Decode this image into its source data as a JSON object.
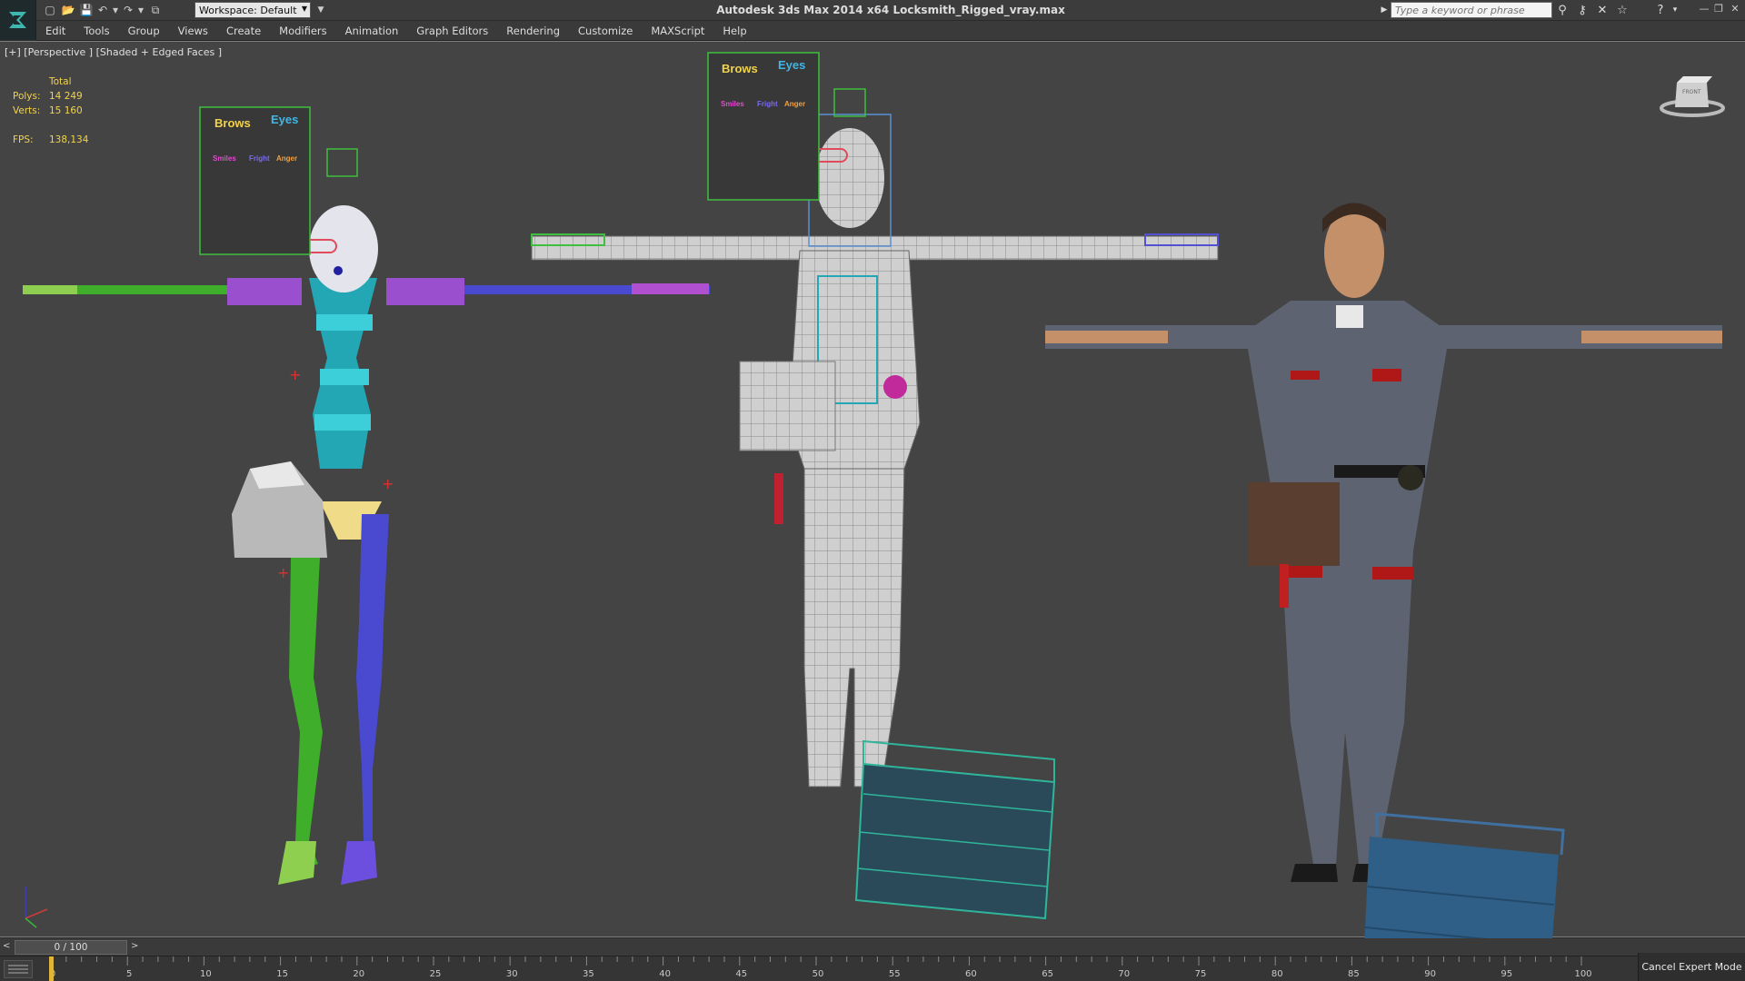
{
  "titlebar": {
    "workspace_label": "Workspace: Default",
    "app_title": "Autodesk 3ds Max  2014 x64     Locksmith_Rigged_vray.max",
    "search_placeholder": "Type a keyword or phrase"
  },
  "menu": [
    "Edit",
    "Tools",
    "Group",
    "Views",
    "Create",
    "Modifiers",
    "Animation",
    "Graph Editors",
    "Rendering",
    "Customize",
    "MAXScript",
    "Help"
  ],
  "viewport": {
    "label": "[+] [Perspective ] [Shaded + Edged Faces ]",
    "stats": {
      "total_label": "Total",
      "polys_label": "Polys:",
      "polys_value": "14 249",
      "verts_label": "Verts:",
      "verts_value": "15 160",
      "fps_label": "FPS:",
      "fps_value": "138,134"
    },
    "face_panel_left": {
      "brows": "Brows",
      "eyes": "Eyes",
      "smiles": "Smiles",
      "fright": "Fright",
      "anger": "Anger"
    },
    "face_panel_right": {
      "brows": "Brows",
      "eyes": "Eyes",
      "smiles": "Smiles",
      "fright": "Fright",
      "anger": "Anger"
    },
    "viewcube_label": "FRONT"
  },
  "timeline": {
    "frame_display": "0 / 100",
    "prev": "<",
    "next": ">",
    "ruler_labels": [
      "0",
      "5",
      "10",
      "15",
      "20",
      "25",
      "30",
      "35",
      "40",
      "45",
      "50",
      "55",
      "60",
      "65",
      "70",
      "75",
      "80",
      "85",
      "90",
      "95",
      "100"
    ]
  },
  "status": {
    "cancel_expert_mode": "Cancel Expert Mode"
  },
  "colors": {
    "stats_text": "#f2d34b",
    "viewport_bg": "#444444",
    "spine_cyan": "#23a7b5",
    "left_leg_green": "#3fae2a",
    "right_leg_blue": "#4a4ad0",
    "clavicle_purple": "#9a4fcf",
    "uniform_gray": "#5d6370",
    "toolbox_blue": "#2f5f86"
  }
}
